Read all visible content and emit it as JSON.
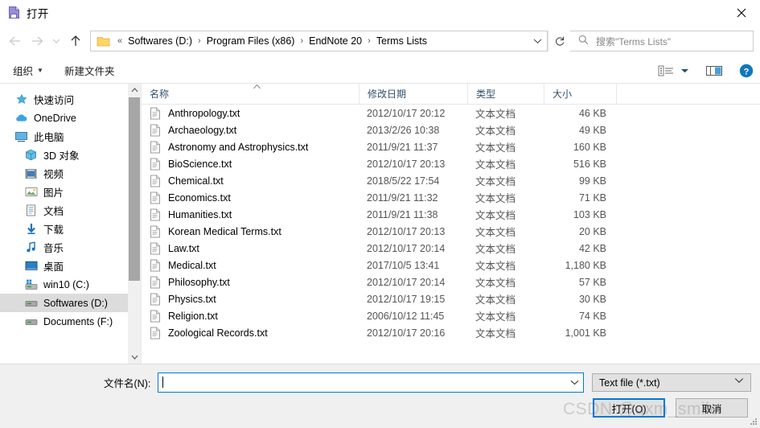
{
  "window": {
    "title": "打开",
    "title_icon": "open-file-icon",
    "close_label": "✕"
  },
  "nav": {
    "back_icon": "arrow-left-icon",
    "forward_icon": "arrow-right-icon",
    "recent_icon": "chevron-down-icon",
    "up_icon": "arrow-up-icon",
    "folder_icon": "folder-icon",
    "overflow": "«",
    "breadcrumbs": [
      {
        "label": "Softwares (D:)"
      },
      {
        "label": "Program Files (x86)"
      },
      {
        "label": "EndNote 20"
      },
      {
        "label": "Terms Lists"
      }
    ],
    "separator": "›",
    "dropdown_icon": "chevron-down-icon",
    "refresh_icon": "refresh-icon",
    "refresh_glyph": "↻"
  },
  "search": {
    "icon": "search-icon",
    "placeholder": "搜索\"Terms Lists\""
  },
  "command_bar": {
    "organize_label": "组织",
    "organize_caret": "▼",
    "new_folder_label": "新建文件夹",
    "view_options_icon": "view-options-icon",
    "view_caret": "▼",
    "preview_pane_icon": "preview-pane-icon",
    "help_icon": "help-icon",
    "help_glyph": "?"
  },
  "sidebar": {
    "items": [
      {
        "label": "快速访问",
        "icon": "pin-star-icon",
        "indent": false,
        "selected": false
      },
      {
        "label": "OneDrive",
        "icon": "cloud-icon",
        "indent": false,
        "selected": false
      },
      {
        "label": "此电脑",
        "icon": "this-pc-icon",
        "indent": false,
        "selected": false
      },
      {
        "label": "3D 对象",
        "icon": "3d-objects-icon",
        "indent": true,
        "selected": false
      },
      {
        "label": "视频",
        "icon": "videos-icon",
        "indent": true,
        "selected": false
      },
      {
        "label": "图片",
        "icon": "pictures-icon",
        "indent": true,
        "selected": false
      },
      {
        "label": "文档",
        "icon": "documents-icon",
        "indent": true,
        "selected": false
      },
      {
        "label": "下载",
        "icon": "downloads-icon",
        "indent": true,
        "selected": false
      },
      {
        "label": "音乐",
        "icon": "music-icon",
        "indent": true,
        "selected": false
      },
      {
        "label": "桌面",
        "icon": "desktop-icon",
        "indent": true,
        "selected": false
      },
      {
        "label": "win10 (C:)",
        "icon": "system-drive-icon",
        "indent": true,
        "selected": false
      },
      {
        "label": "Softwares (D:)",
        "icon": "drive-icon",
        "indent": true,
        "selected": true
      },
      {
        "label": "Documents (F:)",
        "icon": "drive-icon",
        "indent": true,
        "selected": false
      }
    ],
    "scroll_up_glyph": "⌃",
    "scroll_down_glyph": "⌄"
  },
  "filelist": {
    "columns": [
      {
        "key": "name",
        "label": "名称"
      },
      {
        "key": "date",
        "label": "修改日期"
      },
      {
        "key": "type",
        "label": "类型"
      },
      {
        "key": "size",
        "label": "大小"
      }
    ],
    "sort_indicator": "⌃",
    "rows": [
      {
        "name": "Anthropology.txt",
        "date": "2012/10/17 20:12",
        "type": "文本文档",
        "size": "46 KB"
      },
      {
        "name": "Archaeology.txt",
        "date": "2013/2/26 10:38",
        "type": "文本文档",
        "size": "49 KB"
      },
      {
        "name": "Astronomy and Astrophysics.txt",
        "date": "2011/9/21 11:37",
        "type": "文本文档",
        "size": "160 KB"
      },
      {
        "name": "BioScience.txt",
        "date": "2012/10/17 20:13",
        "type": "文本文档",
        "size": "516 KB"
      },
      {
        "name": "Chemical.txt",
        "date": "2018/5/22 17:54",
        "type": "文本文档",
        "size": "99 KB"
      },
      {
        "name": "Economics.txt",
        "date": "2011/9/21 11:32",
        "type": "文本文档",
        "size": "71 KB"
      },
      {
        "name": "Humanities.txt",
        "date": "2011/9/21 11:38",
        "type": "文本文档",
        "size": "103 KB"
      },
      {
        "name": "Korean Medical Terms.txt",
        "date": "2012/10/17 20:13",
        "type": "文本文档",
        "size": "20 KB"
      },
      {
        "name": "Law.txt",
        "date": "2012/10/17 20:14",
        "type": "文本文档",
        "size": "42 KB"
      },
      {
        "name": "Medical.txt",
        "date": "2017/10/5 13:41",
        "type": "文本文档",
        "size": "1,180 KB"
      },
      {
        "name": "Philosophy.txt",
        "date": "2012/10/17 20:14",
        "type": "文本文档",
        "size": "57 KB"
      },
      {
        "name": "Physics.txt",
        "date": "2012/10/17 19:15",
        "type": "文本文档",
        "size": "30 KB"
      },
      {
        "name": "Religion.txt",
        "date": "2006/10/12 11:45",
        "type": "文本文档",
        "size": "74 KB"
      },
      {
        "name": "Zoological Records.txt",
        "date": "2012/10/17 20:16",
        "type": "文本文档",
        "size": "1,001 KB"
      }
    ]
  },
  "footer": {
    "filename_label": "文件名(N):",
    "filename_value": "",
    "filename_placeholder": "",
    "filter_value": "Text file  (*.txt)",
    "filter_caret": "⌄",
    "open_label": "打开(O)",
    "cancel_label": "取消",
    "resize_grip_icon": "resize-grip-icon"
  },
  "watermark": {
    "text": "CSDN @qxm_smile"
  },
  "colors": {
    "accent": "#0078d7",
    "selection": "#dcdcdc",
    "header_text": "#30506b",
    "button_face": "#e1e1e1"
  }
}
